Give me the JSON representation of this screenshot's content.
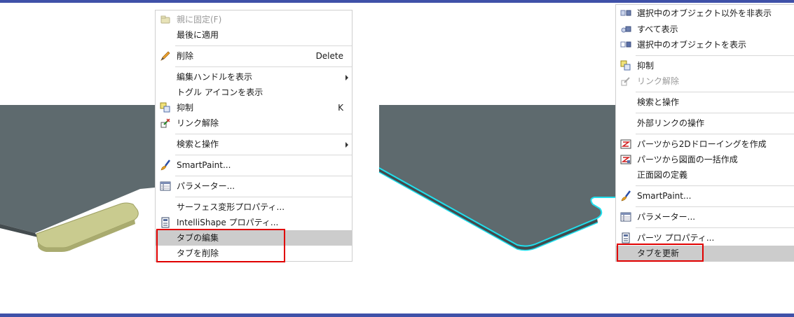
{
  "colors": {
    "accent_bar": "#3f51a8",
    "part_face": "#5e6a6e",
    "tab_highlight": "#c9cb8f",
    "selection_outline": "#1fe0ee",
    "menu_highlight": "#cccccc",
    "callout": "#e00000"
  },
  "left_menu": {
    "items": [
      {
        "label": "親に固定(F)",
        "icon": "folder-lock-icon",
        "disabled": true
      },
      {
        "label": "最後に適用"
      },
      {
        "label": "削除",
        "shortcut": "Delete",
        "icon": "pencil-eraser-icon"
      },
      {
        "label": "編集ハンドルを表示",
        "submenu": true
      },
      {
        "label": "トグル アイコンを表示"
      },
      {
        "label": "抑制",
        "shortcut": "K",
        "icon": "suppress-icon"
      },
      {
        "label": "リンク解除",
        "icon": "unlink-icon"
      },
      {
        "label": "検索と操作",
        "submenu": true
      },
      {
        "label": "SmartPaint...",
        "icon": "paintbrush-icon"
      },
      {
        "label": "パラメーター...",
        "icon": "parameters-table-icon"
      },
      {
        "label": "サーフェス変形プロパティ..."
      },
      {
        "label": "IntelliShape プロパティ...",
        "icon": "properties-icon"
      },
      {
        "label": "タブの編集",
        "highlighted": true
      },
      {
        "label": "タブを削除"
      }
    ]
  },
  "right_menu": {
    "items": [
      {
        "label": "選択中のオブジェクト以外を非表示",
        "icon": "hide-others-icon"
      },
      {
        "label": "すべて表示",
        "icon": "show-all-icon"
      },
      {
        "label": "選択中のオブジェクトを表示",
        "icon": "show-selected-icon"
      },
      {
        "label": "抑制",
        "icon": "suppress-icon"
      },
      {
        "label": "リンク解除",
        "icon": "unlink-icon",
        "disabled": true
      },
      {
        "label": "検索と操作"
      },
      {
        "label": "外部リンクの操作"
      },
      {
        "label": "パーツから2Dドローイングを作成",
        "icon": "drawing-2d-icon"
      },
      {
        "label": "パーツから図面の一括作成",
        "icon": "batch-drawing-icon"
      },
      {
        "label": "正面図の定義"
      },
      {
        "label": "SmartPaint...",
        "icon": "paintbrush-icon"
      },
      {
        "label": "パラメーター...",
        "icon": "parameters-table-icon"
      },
      {
        "label": "パーツ プロパティ...",
        "icon": "properties-icon"
      },
      {
        "label": "タブを更新",
        "highlighted": true
      }
    ]
  }
}
